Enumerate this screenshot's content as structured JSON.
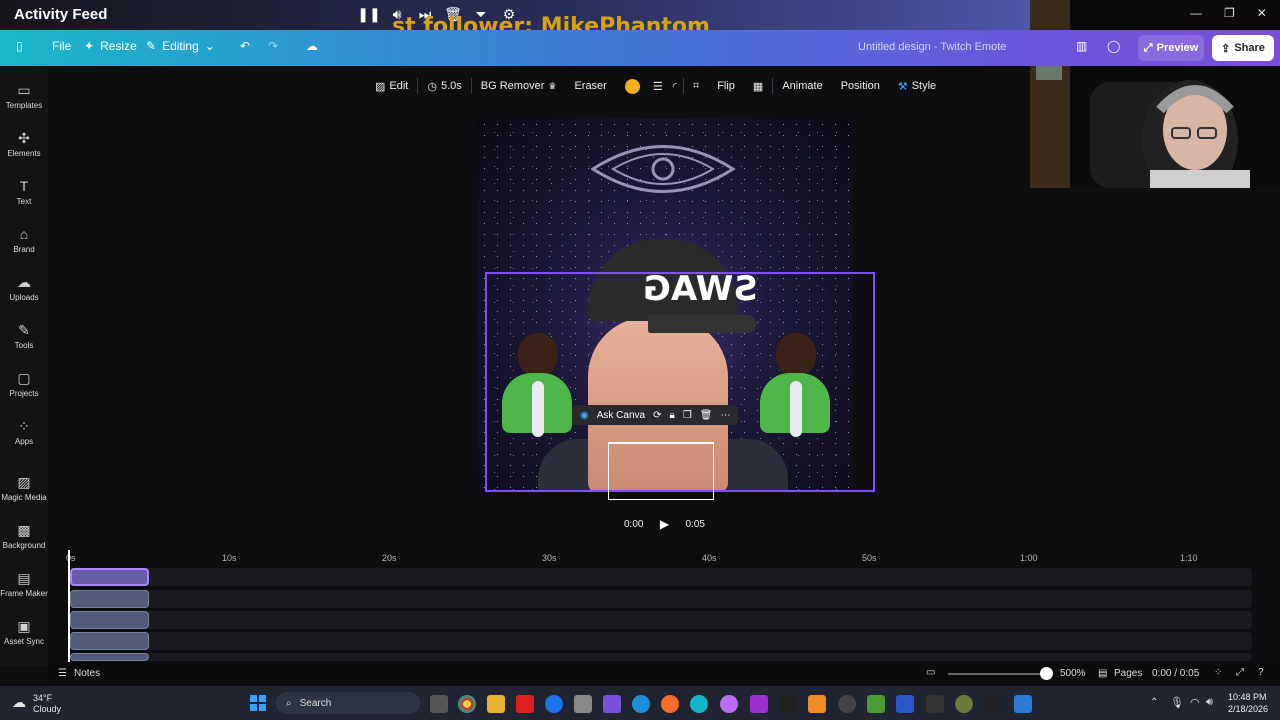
{
  "stream_overlay": {
    "title": "Activity Feed",
    "follower_text": "st follower: MikePhantom"
  },
  "header": {
    "file": "File",
    "resize": "Resize",
    "editing": "Editing",
    "design_title": "Untitled design - Twitch Emote",
    "preview": "Preview",
    "share": "Share"
  },
  "sidebar": {
    "items": [
      {
        "label": "Templates",
        "icon": "templates-icon"
      },
      {
        "label": "Elements",
        "icon": "elements-icon"
      },
      {
        "label": "Text",
        "icon": "text-icon"
      },
      {
        "label": "Brand",
        "icon": "brand-icon"
      },
      {
        "label": "Uploads",
        "icon": "uploads-icon"
      },
      {
        "label": "Tools",
        "icon": "tools-icon"
      },
      {
        "label": "Projects",
        "icon": "projects-icon"
      },
      {
        "label": "Apps",
        "icon": "apps-icon"
      },
      {
        "label": "Magic Media",
        "icon": "magic-media-icon"
      },
      {
        "label": "Background",
        "icon": "background-icon"
      },
      {
        "label": "Frame Maker",
        "icon": "frame-maker-icon"
      },
      {
        "label": "Asset Sync",
        "icon": "asset-sync-icon"
      }
    ]
  },
  "toolbar": {
    "edit": "Edit",
    "duration": "5.0s",
    "bg_remover": "BG Remover",
    "eraser": "Eraser",
    "flip": "Flip",
    "animate": "Animate",
    "position": "Position",
    "style": "Style",
    "swatch_color": "#f2b01e"
  },
  "canvas": {
    "cap_text": "SWAG",
    "ask_canva": "Ask Canva"
  },
  "playback": {
    "current": "0:00",
    "total": "0:05"
  },
  "timeline": {
    "ticks": [
      "0s",
      "10s",
      "20s",
      "30s",
      "40s",
      "50s",
      "1:00",
      "1:10"
    ]
  },
  "bottom_bar": {
    "notes": "Notes",
    "zoom": "500%",
    "pages": "Pages",
    "time": "0:00 / 0:05"
  },
  "taskbar": {
    "weather_temp": "34°F",
    "weather_desc": "Cloudy",
    "search": "Search",
    "clock_time": "10:48 PM",
    "clock_date": "2/18/2026"
  }
}
